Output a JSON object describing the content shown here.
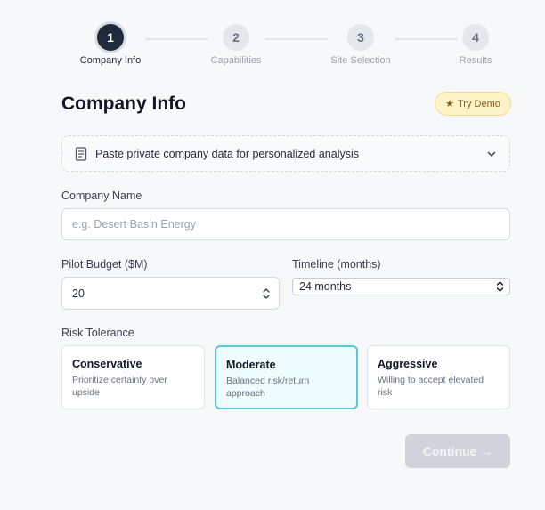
{
  "stepper": {
    "steps": [
      {
        "number": "1",
        "label": "Company Info"
      },
      {
        "number": "2",
        "label": "Capabilities"
      },
      {
        "number": "3",
        "label": "Site Selection"
      },
      {
        "number": "4",
        "label": "Results"
      }
    ],
    "active_step": 1
  },
  "header": {
    "title": "Company Info",
    "demo_label": "Try Demo",
    "demo_icon": "star-icon"
  },
  "paste": {
    "label": "Paste private company data for personalized analysis",
    "icon": "document-icon"
  },
  "company_name": {
    "label": "Company Name",
    "value": "",
    "placeholder": "e.g. Desert Basin Energy"
  },
  "pilot_budget": {
    "label": "Pilot Budget ($M)",
    "value": "20"
  },
  "timeline": {
    "label": "Timeline (months)",
    "selected": "24 months"
  },
  "risk": {
    "label": "Risk Tolerance",
    "options": [
      {
        "title": "Conservative",
        "description": "Prioritize certainty over upside",
        "selected": false
      },
      {
        "title": "Moderate",
        "description": "Balanced risk/return approach",
        "selected": true
      },
      {
        "title": "Aggressive",
        "description": "Willing to accept elevated risk",
        "selected": false
      }
    ]
  },
  "continue": {
    "label": "Continue →",
    "enabled": false
  },
  "colors": {
    "primary_dark": "#1f2a3c",
    "accent_teal": "#5ec6d3",
    "demo_bg": "#fdf3c8",
    "disabled_btn": "#d0d4da"
  }
}
